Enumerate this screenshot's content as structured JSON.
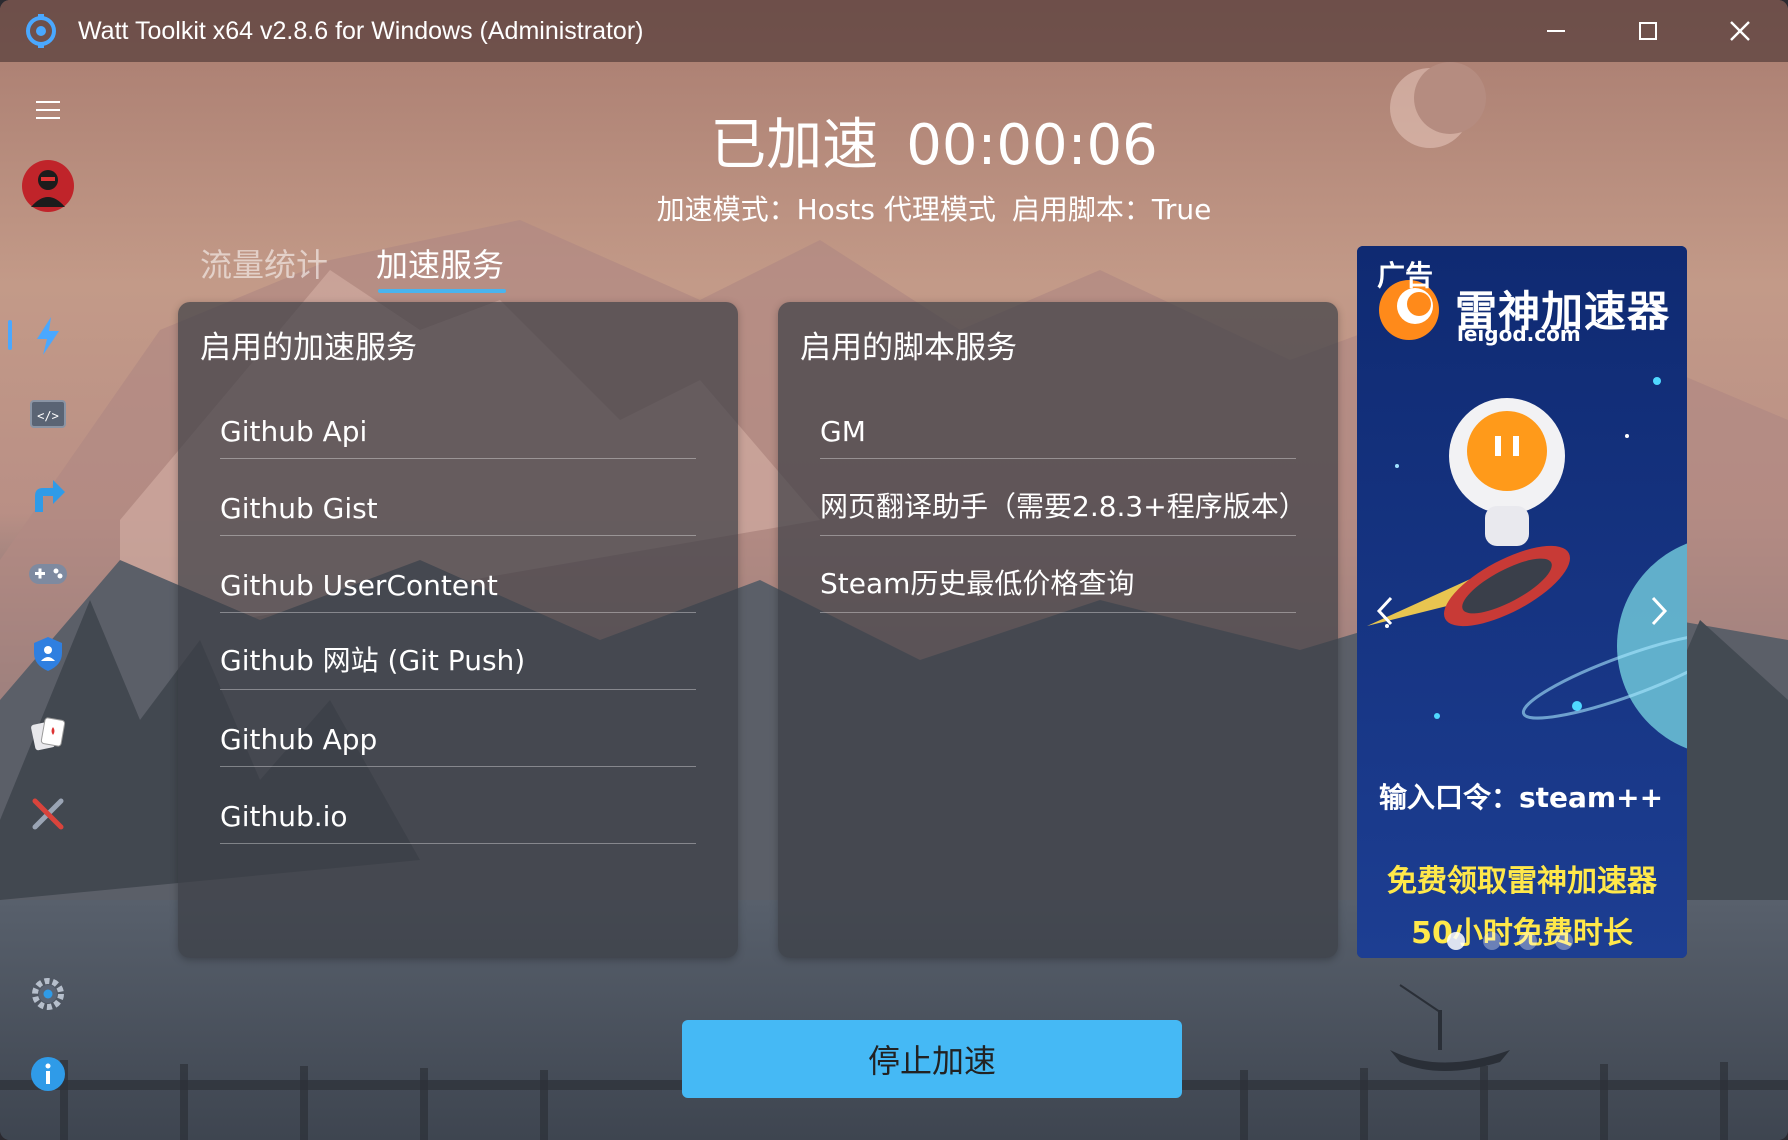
{
  "window": {
    "title": "Watt Toolkit x64 v2.8.6 for Windows (Administrator)",
    "controls": [
      "minimize-icon",
      "maximize-icon",
      "close-icon"
    ]
  },
  "sidebar": {
    "items": [
      {
        "name": "menu",
        "icon": "hamburger-menu-icon"
      },
      {
        "name": "avatar",
        "icon": "user-avatar"
      },
      {
        "name": "accelerate",
        "icon": "lightning-icon",
        "active": true
      },
      {
        "name": "script",
        "icon": "code-window-icon"
      },
      {
        "name": "steam-tools",
        "icon": "arrow-up-right-icon"
      },
      {
        "name": "game-list",
        "icon": "gamepad-icon"
      },
      {
        "name": "account",
        "icon": "shield-user-icon"
      },
      {
        "name": "authenticator",
        "icon": "playing-cards-icon"
      },
      {
        "name": "tools",
        "icon": "wrench-screwdriver-icon"
      },
      {
        "name": "settings",
        "icon": "gear-icon"
      },
      {
        "name": "about",
        "icon": "info-icon"
      }
    ]
  },
  "status": {
    "label": "已加速",
    "timer": "00:00:06",
    "mode_label": "加速模式：Hosts 代理模式",
    "script_label": "启用脚本：True"
  },
  "tabs": [
    {
      "label": "流量统计",
      "active": false
    },
    {
      "label": "加速服务",
      "active": true
    }
  ],
  "accel_panel": {
    "title": "启用的加速服务",
    "items": [
      "Github Api",
      "Github Gist",
      "Github UserContent",
      "Github 网站 (Git Push)",
      "Github App",
      "Github.io"
    ]
  },
  "script_panel": {
    "title": "启用的脚本服务",
    "items": [
      "GM",
      "网页翻译助手（需要2.8.3+程序版本）",
      "Steam历史最低价格查询"
    ]
  },
  "ad": {
    "label": "广告",
    "brand": "雷神加速器",
    "domain": "leigod.com",
    "code_text": "输入口令：steam++",
    "free_line1": "免费领取雷神加速器",
    "free_line2": "50小时免费时长",
    "dots": 4,
    "active_dot": 0
  },
  "stop_button": {
    "label": "停止加速"
  },
  "colors": {
    "accent": "#45b9f5",
    "tab_underline": "#4ab4ee",
    "active_nav": "#4aa8ff"
  }
}
